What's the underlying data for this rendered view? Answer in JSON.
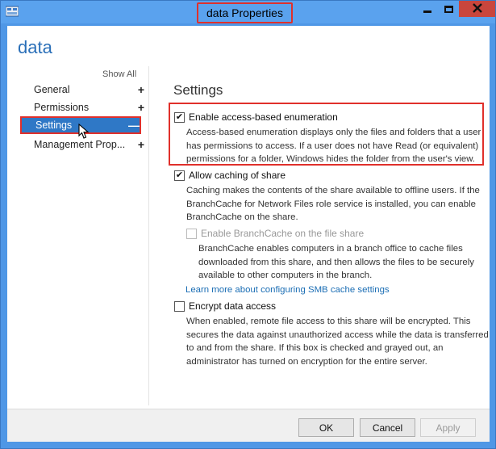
{
  "window": {
    "title": "data Properties"
  },
  "page": {
    "heading": "data"
  },
  "nav": {
    "show_all": "Show All",
    "items": [
      {
        "label": "General",
        "sign": "+"
      },
      {
        "label": "Permissions",
        "sign": "+"
      },
      {
        "label": "Settings",
        "sign": "—",
        "selected": true
      },
      {
        "label": "Management Prop...",
        "sign": "+"
      }
    ]
  },
  "settings": {
    "title": "Settings",
    "abe": {
      "label": "Enable access-based enumeration",
      "checked": true,
      "desc1": "Access-based enumeration displays only the files and folders that a user",
      "desc2": "has permissions to access. If a user does not have Read (or equivalent)",
      "desc3": "permissions for a folder, Windows hides the folder from the user's view."
    },
    "caching": {
      "label": "Allow caching of share",
      "checked": true,
      "desc1": "Caching makes the contents of the share available to offline users. If the",
      "desc2": "BranchCache for Network Files role service is installed, you can enable",
      "desc3": "BranchCache on the share."
    },
    "branchcache": {
      "label": "Enable BranchCache on the file share",
      "checked": false,
      "disabled": true,
      "desc1": "BranchCache enables computers in a branch office to cache files",
      "desc2": "downloaded from this share, and then allows the files to be securely",
      "desc3": "available to other computers in the branch."
    },
    "smb_link": "Learn more about configuring SMB cache settings",
    "encrypt": {
      "label": "Encrypt data access",
      "checked": false,
      "desc1": "When enabled, remote file access to this share will be encrypted. This",
      "desc2": "secures the data against unauthorized access while the data is transferred",
      "desc3": "to and from the share. If this box is checked and grayed out, an",
      "desc4": "administrator has turned on encryption for the entire server."
    }
  },
  "footer": {
    "ok": "OK",
    "cancel": "Cancel",
    "apply": "Apply"
  },
  "colors": {
    "accent": "#2f78c6",
    "highlight_box": "#e0302b",
    "heading": "#2a6fb8",
    "link": "#1a6db4"
  },
  "icons": {
    "app": "server-manager-icon",
    "minimize": "minimize-icon",
    "maximize": "maximize-icon",
    "close": "close-icon",
    "cursor": "mouse-pointer-icon"
  }
}
